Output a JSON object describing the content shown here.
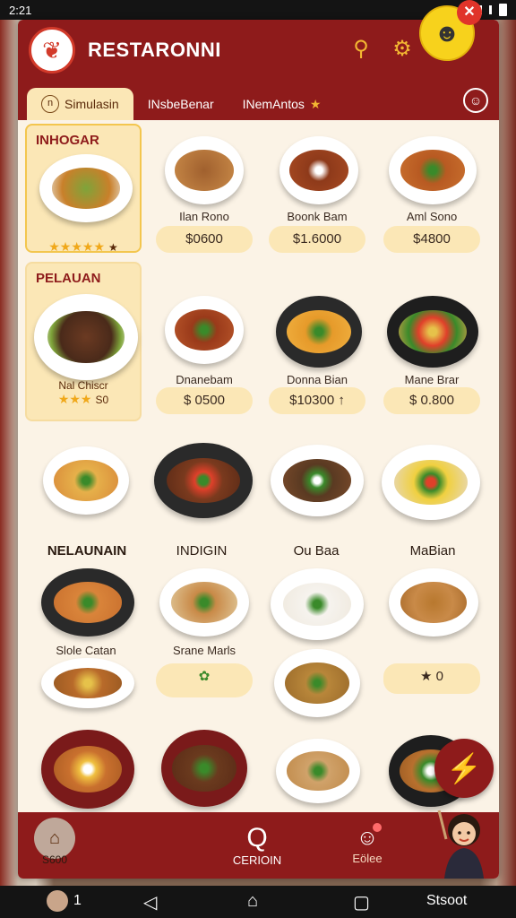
{
  "status": {
    "time": "2:21"
  },
  "app": {
    "title": "RESTARONNI"
  },
  "tabs": [
    {
      "label": "Simulasin",
      "active": true
    },
    {
      "label": "INsbeBenar",
      "active": false
    },
    {
      "label": "INemAntos",
      "active": false
    }
  ],
  "side_cards": [
    {
      "title": "INHOGAR",
      "name": "",
      "rating": "★★★★★",
      "count": "★"
    },
    {
      "title": "PELAUAN",
      "name": "Nal Chiscr",
      "rating": "★★★",
      "count": "S0"
    }
  ],
  "row1": [
    {
      "label": "Ilan Rono",
      "price": "$0600"
    },
    {
      "label": "Boonk Bam",
      "price": "$1.6000"
    },
    {
      "label": "Aml Sono",
      "price": "$4800"
    }
  ],
  "row2": [
    {
      "label": "Dnanebam",
      "price": "$ 0500"
    },
    {
      "label": "Donna Bian",
      "price": "$10300 ↑"
    },
    {
      "label": "Mane Brar",
      "price": "$ 0.800"
    }
  ],
  "row3_headings": [
    "NELAUNAIN",
    "INDIGIN",
    "Ou Baa",
    "MaBian"
  ],
  "row4": [
    {
      "label": "Slole Catan"
    },
    {
      "label": "Srane Marls"
    }
  ],
  "row5_price": "★ 0",
  "bottom_nav": {
    "home_label": "S600",
    "search_label": "CERIOIN",
    "offers_label": "Eölee"
  },
  "system_nav": {
    "num": "1",
    "right": "Stsoot"
  },
  "colors": {
    "brand": "#8e1b1b",
    "accent": "#f3b732",
    "cream": "#fbe7b6"
  }
}
